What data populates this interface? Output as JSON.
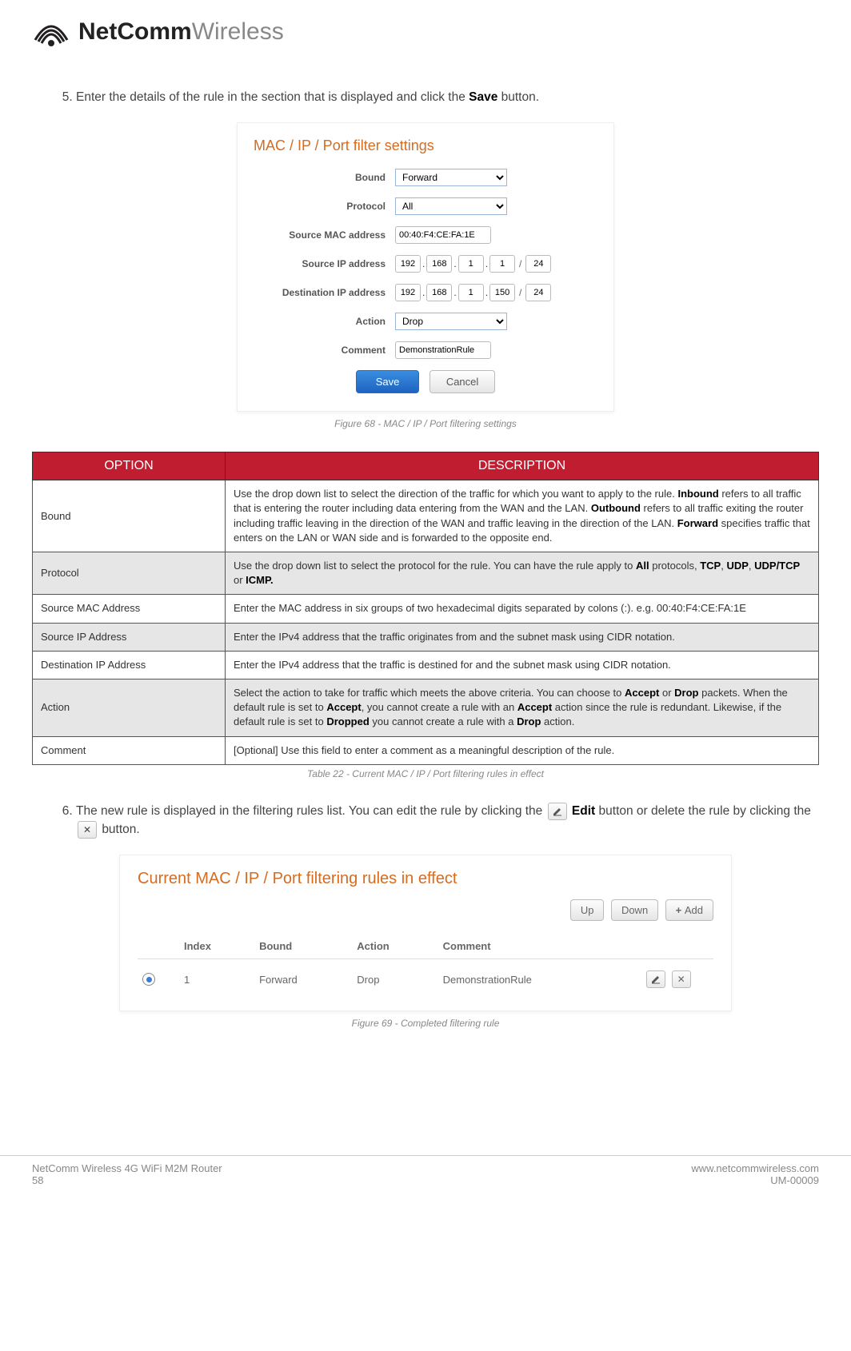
{
  "brand": {
    "bold": "NetComm",
    "light": "Wireless"
  },
  "step5": {
    "num": "5.",
    "text_a": "Enter the details of the rule in the section that is displayed and click the ",
    "save": "Save",
    "text_b": " button."
  },
  "panel": {
    "title": "MAC / IP / Port filter settings",
    "labels": {
      "bound": "Bound",
      "protocol": "Protocol",
      "src_mac": "Source MAC address",
      "src_ip": "Source IP address",
      "dst_ip": "Destination IP address",
      "action": "Action",
      "comment": "Comment"
    },
    "values": {
      "bound": "Forward",
      "protocol": "All",
      "src_mac": "00:40:F4:CE:FA:1E",
      "src_ip": [
        "192",
        "168",
        "1",
        "1",
        "24"
      ],
      "dst_ip": [
        "192",
        "168",
        "1",
        "150",
        "24"
      ],
      "action": "Drop",
      "comment": "DemonstrationRule"
    },
    "buttons": {
      "save": "Save",
      "cancel": "Cancel"
    }
  },
  "fig68": "Figure 68 - MAC / IP / Port filtering settings",
  "tableHead": {
    "option": "OPTION",
    "desc": "DESCRIPTION"
  },
  "rows": [
    {
      "opt": "Bound",
      "desc_parts": [
        {
          "t": "Use the drop down list to select the direction of the traffic for which you want to apply to the rule. "
        },
        {
          "b": "Inbound"
        },
        {
          "t": " refers to all traffic that is entering the router including data entering from the WAN and the LAN. "
        },
        {
          "b": "Outbound"
        },
        {
          "t": " refers to all traffic exiting the router including traffic leaving in the direction of the WAN and traffic leaving in the direction of the LAN. "
        },
        {
          "b": "Forward"
        },
        {
          "t": " specifies traffic that enters on the LAN or WAN side and is forwarded to the opposite end."
        }
      ]
    },
    {
      "opt": "Protocol",
      "desc_parts": [
        {
          "t": "Use the drop down list to select the protocol for the rule. You can have the rule apply to "
        },
        {
          "b": "All"
        },
        {
          "t": " protocols, "
        },
        {
          "b": "TCP"
        },
        {
          "t": ", "
        },
        {
          "b": "UDP"
        },
        {
          "t": ", "
        },
        {
          "b": "UDP/TCP"
        },
        {
          "t": " or "
        },
        {
          "b": "ICMP."
        }
      ]
    },
    {
      "opt": "Source MAC Address",
      "desc_parts": [
        {
          "t": "Enter the MAC address in six groups of two hexadecimal digits separated by colons (:). e.g. 00:40:F4:CE:FA:1E"
        }
      ]
    },
    {
      "opt": "Source IP Address",
      "desc_parts": [
        {
          "t": "Enter the IPv4 address that the traffic originates from and the subnet mask using CIDR notation."
        }
      ]
    },
    {
      "opt": "Destination IP Address",
      "desc_parts": [
        {
          "t": "Enter the IPv4 address that the traffic is destined for and the subnet mask using CIDR notation."
        }
      ]
    },
    {
      "opt": "Action",
      "desc_parts": [
        {
          "t": "Select the action to take for traffic which meets the above criteria. You can choose to "
        },
        {
          "b": "Accept"
        },
        {
          "t": " or "
        },
        {
          "b": "Drop"
        },
        {
          "t": " packets. When the default rule is set to "
        },
        {
          "b": "Accept"
        },
        {
          "t": ", you cannot create a rule with an "
        },
        {
          "b": "Accept"
        },
        {
          "t": " action since the rule is redundant. Likewise, if the default rule is set to "
        },
        {
          "b": "Dropped"
        },
        {
          "t": " you cannot create a rule with a "
        },
        {
          "b": "Drop"
        },
        {
          "t": " action."
        }
      ]
    },
    {
      "opt": "Comment",
      "desc_parts": [
        {
          "t": "[Optional] Use this field to enter a comment as a meaningful description of the rule."
        }
      ]
    }
  ],
  "tab22": "Table 22 - Current MAC / IP / Port filtering rules in effect",
  "step6": {
    "num": "6.",
    "a": "The new rule is displayed in the filtering rules list. You can edit the rule by clicking the ",
    "edit": "Edit",
    "b": " button or delete the rule by clicking the ",
    "c": " button."
  },
  "rules": {
    "title": "Current MAC / IP / Port filtering rules in effect",
    "btns": {
      "up": "Up",
      "down": "Down",
      "add": "Add"
    },
    "head": {
      "index": "Index",
      "bound": "Bound",
      "action": "Action",
      "comment": "Comment"
    },
    "row": {
      "index": "1",
      "bound": "Forward",
      "action": "Drop",
      "comment": "DemonstrationRule"
    }
  },
  "fig69": "Figure 69 - Completed filtering rule",
  "footer": {
    "l1": "NetComm Wireless 4G WiFi M2M Router",
    "l2": "58",
    "r1": "www.netcommwireless.com",
    "r2": "UM-00009"
  }
}
